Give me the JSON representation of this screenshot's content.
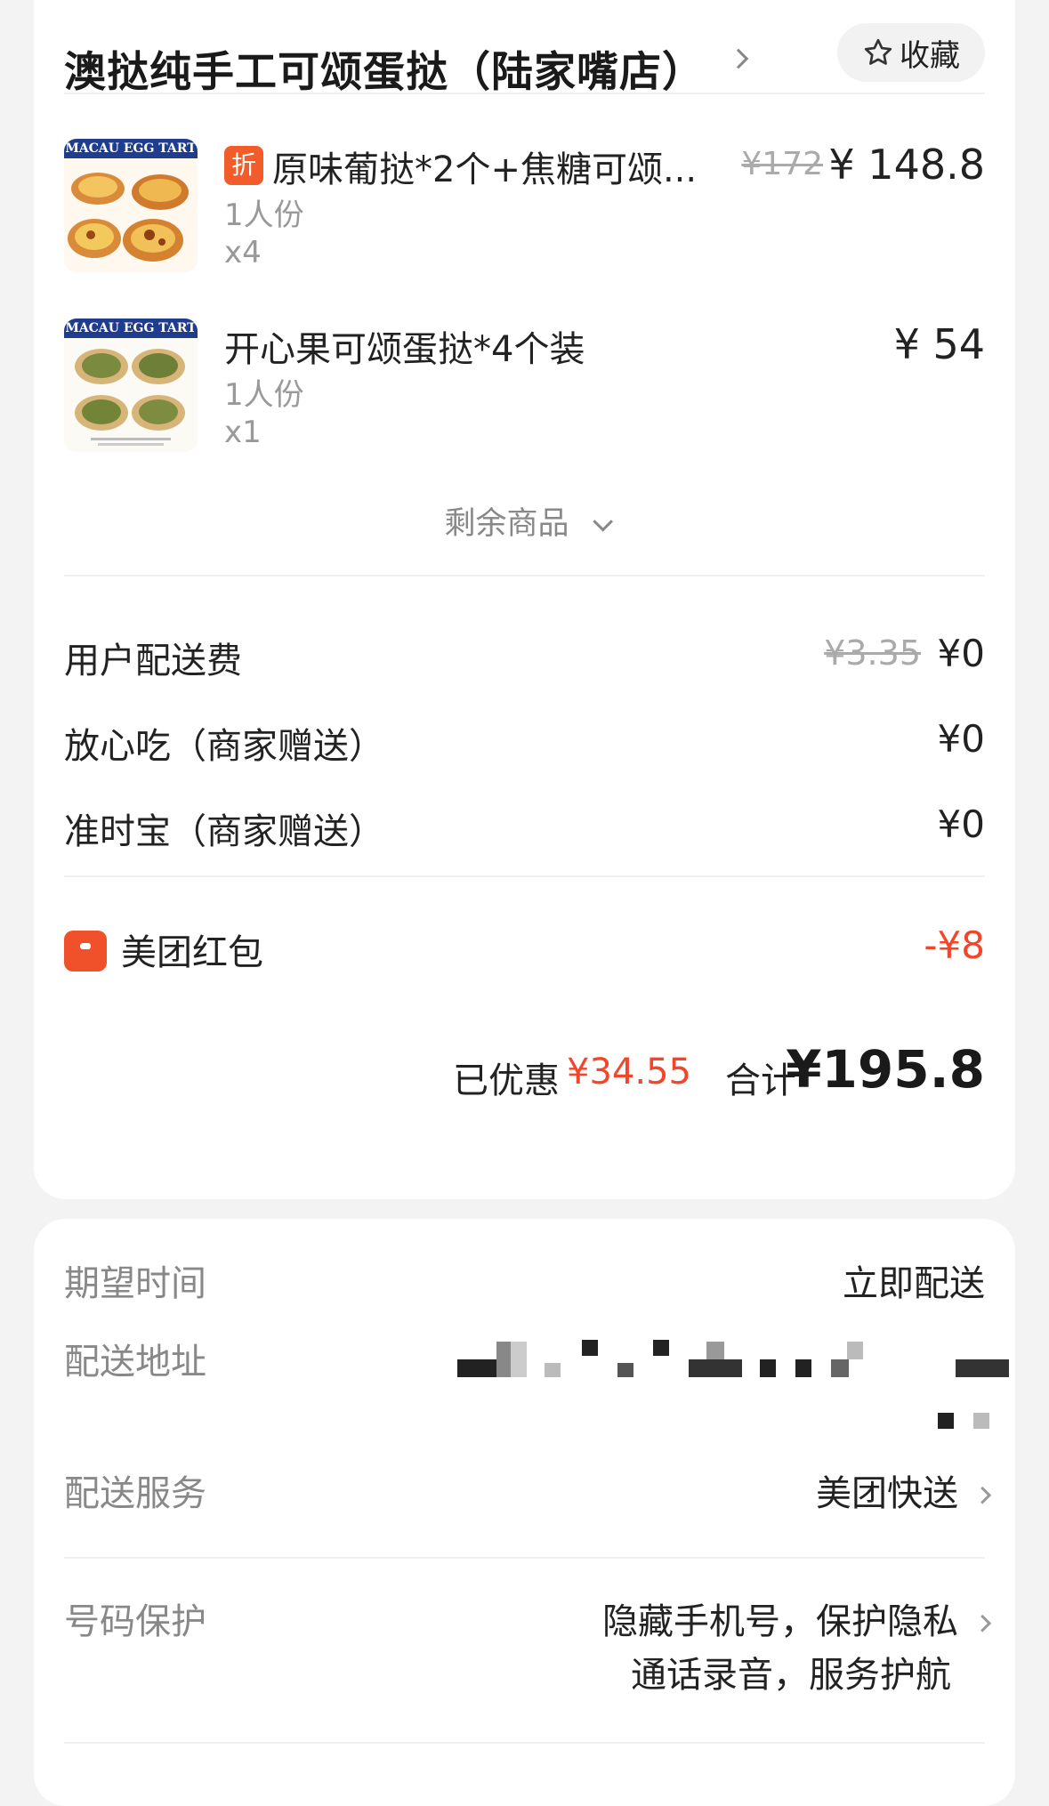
{
  "shop": {
    "name": "澳挞纯手工可颂蛋挞（陆家嘴店）",
    "favorite_label": "收藏"
  },
  "items": [
    {
      "thumb_text": "MACAU EGG TART",
      "discount_badge": "折",
      "title": "原味葡挞*2个+焦糖可颂...",
      "original_price": "¥172",
      "price": "¥ 148.8",
      "portion": "1人份",
      "quantity": "x4"
    },
    {
      "thumb_text": "MACAU EGG TART",
      "title": "开心果可颂蛋挞*4个装",
      "price": "¥ 54",
      "portion": "1人份",
      "quantity": "x1"
    }
  ],
  "more_items_label": "剩余商品",
  "fees": [
    {
      "label": "用户配送费",
      "original": "¥3.35",
      "value": "¥0"
    },
    {
      "label": "放心吃（商家赠送）",
      "value": "¥0"
    },
    {
      "label": "准时宝（商家赠送）",
      "value": "¥0"
    }
  ],
  "red_packet": {
    "label": "美团红包",
    "value": "-¥8"
  },
  "summary": {
    "saved_label": "已优惠",
    "saved_value": "¥34.55",
    "total_label": "合计",
    "total_value": "¥195.8"
  },
  "delivery": {
    "expected_time_label": "期望时间",
    "expected_time_value": "立即配送",
    "address_label": "配送地址",
    "service_label": "配送服务",
    "service_value": "美团快送",
    "privacy_label": "号码保护",
    "privacy_value_line1": "隐藏手机号，保护隐私",
    "privacy_value_line2": "通话录音，服务护航"
  },
  "colors": {
    "accent_red": "#f2452a",
    "badge_orange": "#f25c2a",
    "page_bg": "#f3f3f3"
  }
}
